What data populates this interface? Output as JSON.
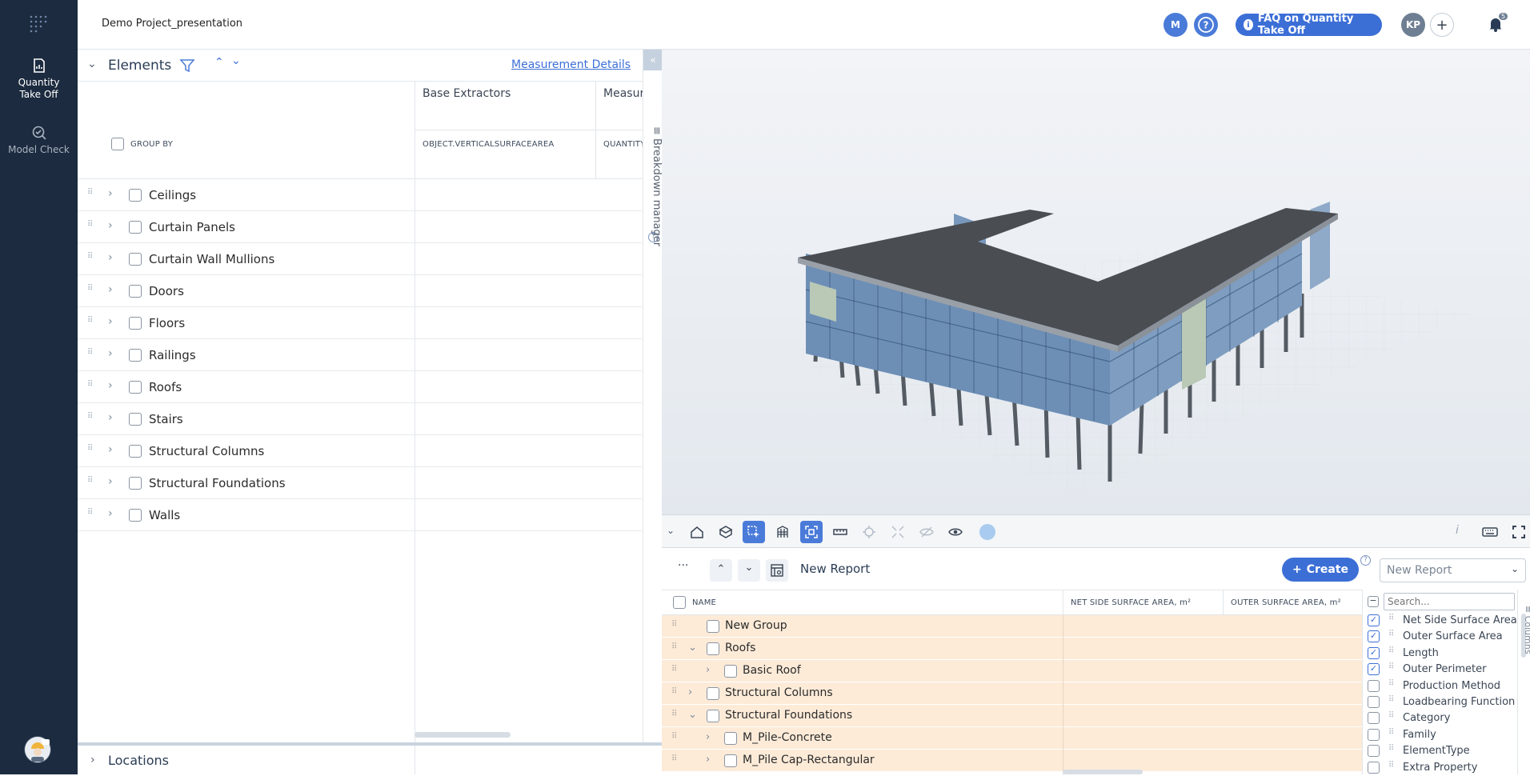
{
  "sidebar": {
    "items": [
      {
        "label_line1": "Quantity",
        "label_line2": "Take Off",
        "icon": "quantity-takeoff-icon",
        "active": true
      },
      {
        "label": "Model Check",
        "icon": "model-check-icon",
        "active": false
      }
    ]
  },
  "header": {
    "project_title": "Demo Project_presentation",
    "user_initial": "M",
    "faq_label": "FAQ on Quantity Take Off",
    "avatar_initials": "KP",
    "notification_count": "5"
  },
  "elements_panel": {
    "title": "Elements",
    "measurement_link": "Measurement Details",
    "columns": [
      {
        "title": "Base Extractors",
        "sub": "OBJECT.VERTICALSURFACEAREA"
      },
      {
        "title": "Measur",
        "sub": "QUANTITY"
      }
    ],
    "group_by_label": "GROUP BY",
    "rows": [
      "Ceilings",
      "Curtain Panels",
      "Curtain Wall Mullions",
      "Doors",
      "Floors",
      "Railings",
      "Roofs",
      "Stairs",
      "Structural Columns",
      "Structural Foundations",
      "Walls"
    ],
    "breakdown_manager_label": "Breakdown manager",
    "locations_label": "Locations"
  },
  "report": {
    "more_label": "···",
    "name": "New Report",
    "create_label": "Create",
    "select_value": "New Report",
    "columns": [
      "NAME",
      "NET SIDE SURFACE AREA, m²",
      "OUTER SURFACE AREA, m²"
    ],
    "rows": [
      {
        "label": "New Group",
        "level": 0,
        "expander": "none"
      },
      {
        "label": "Roofs",
        "level": 0,
        "expander": "open"
      },
      {
        "label": "Basic Roof",
        "level": 1,
        "expander": "closed"
      },
      {
        "label": "Structural Columns",
        "level": 0,
        "expander": "closed"
      },
      {
        "label": "Structural Foundations",
        "level": 0,
        "expander": "open"
      },
      {
        "label": "M_Pile-Concrete",
        "level": 1,
        "expander": "closed"
      },
      {
        "label": "M_Pile Cap-Rectangular",
        "level": 1,
        "expander": "closed"
      }
    ]
  },
  "columns_panel": {
    "search_placeholder": "Search...",
    "tab_label": "Columns",
    "items": [
      {
        "label": "Net Side Surface Area",
        "checked": true
      },
      {
        "label": "Outer Surface Area",
        "checked": true
      },
      {
        "label": "Length",
        "checked": true
      },
      {
        "label": "Outer Perimeter",
        "checked": true
      },
      {
        "label": "Production Method",
        "checked": false
      },
      {
        "label": "Loadbearing Function",
        "checked": false
      },
      {
        "label": "Category",
        "checked": false
      },
      {
        "label": "Family",
        "checked": false
      },
      {
        "label": "ElementType",
        "checked": false
      },
      {
        "label": "Extra Property",
        "checked": false
      }
    ]
  },
  "colors": {
    "sidebar_bg": "#1c2b3f",
    "accent": "#3c6fd6",
    "row_highlight": "#fdebd8"
  }
}
